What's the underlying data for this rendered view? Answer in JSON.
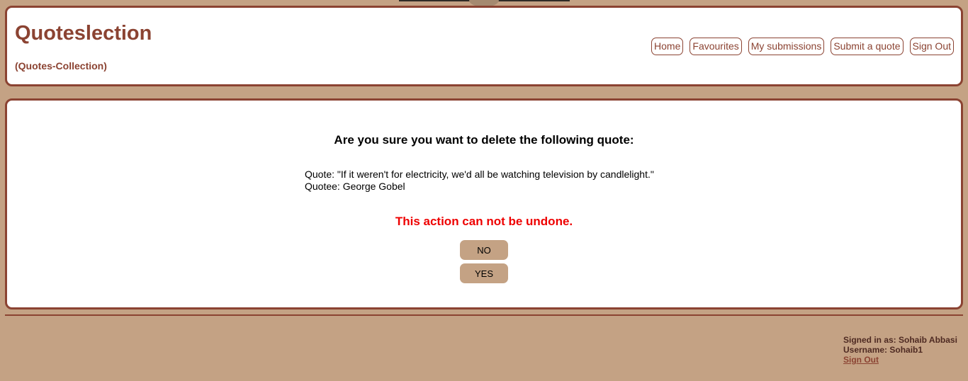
{
  "header": {
    "title": "Quoteslection",
    "subtitle": "(Quotes-Collection)",
    "nav": [
      "Home",
      "Favourites",
      "My submissions",
      "Submit a quote",
      "Sign Out"
    ]
  },
  "confirm": {
    "heading": "Are you sure you want to delete the following quote:",
    "quote_line": "Quote: \"If it weren't for electricity, we'd all be watching television by candlelight.\"",
    "quotee_line": "Quotee: George Gobel",
    "warning": "This action can not be undone.",
    "no_label": "NO",
    "yes_label": "YES"
  },
  "footer": {
    "signed_in": "Signed in as: Sohaib Abbasi",
    "username": "Username: Sohaib1",
    "signout": "Sign Out"
  },
  "colors": {
    "background": "#c4a284",
    "accent": "#8b4332",
    "warning": "#ee0000"
  }
}
